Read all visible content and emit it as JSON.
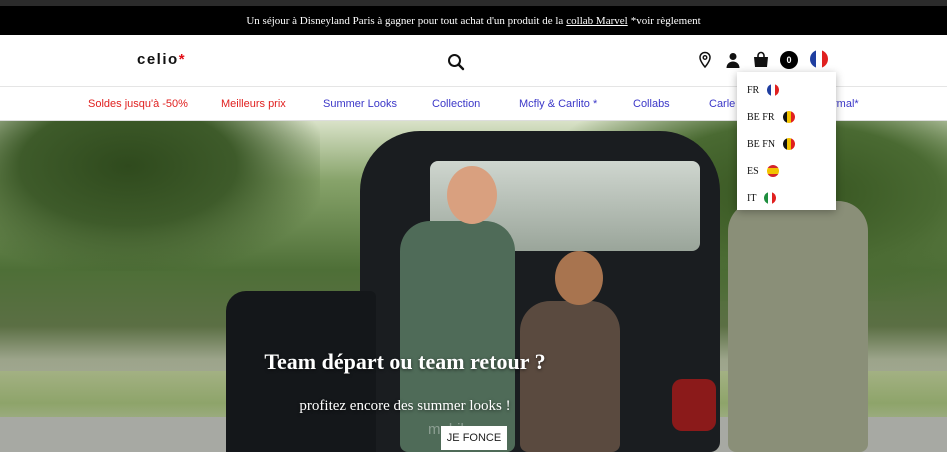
{
  "promo": {
    "text_before": "Un séjour à Disneyland Paris à gagner pour tout achat d'un produit de la",
    "link": "collab Marvel",
    "text_after": "*voir règlement"
  },
  "header": {
    "logo": "celio",
    "logo_star": "*",
    "cart_count": "0",
    "icons": [
      "search-icon",
      "location-pin-icon",
      "account-icon",
      "shopping-bag-icon",
      "french-flag-icon"
    ]
  },
  "nav": {
    "items": [
      {
        "label": "Soldes jusqu'à -50%",
        "color": "#e0201f"
      },
      {
        "label": "Meilleurs prix",
        "color": "#e0201f"
      },
      {
        "label": "Summer Looks",
        "color": "#3b37c8"
      },
      {
        "label": "Collection",
        "color": "#3b37c8"
      },
      {
        "label": "Mcfly & Carlito *",
        "color": "#3b37c8"
      },
      {
        "label": "Collabs",
        "color": "#3b37c8"
      },
      {
        "label": "Carle",
        "color": "#3b37c8"
      },
      {
        "label": "rmal*",
        "color": "#3b37c8"
      }
    ]
  },
  "hero": {
    "title": "Team départ ou team retour ?",
    "subtitle": "profitez encore des summer looks !",
    "cta": "JE FONCE",
    "watermark": "mobile.com"
  },
  "language_menu": {
    "items": [
      {
        "label": "FR",
        "flag": "france-flag-icon"
      },
      {
        "label": "BE FR",
        "flag": "belgium-flag-icon"
      },
      {
        "label": "BE FN",
        "flag": "belgium-flag-icon"
      },
      {
        "label": "ES",
        "flag": "spain-flag-icon"
      },
      {
        "label": "IT",
        "flag": "italy-flag-icon"
      }
    ]
  }
}
